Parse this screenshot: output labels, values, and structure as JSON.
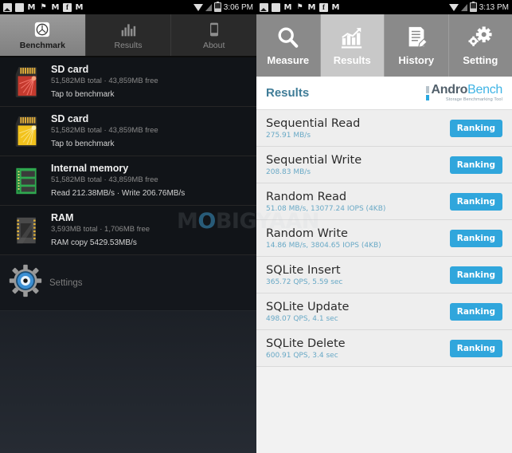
{
  "left_phone": {
    "statusbar": {
      "icons": [
        "photo-icon",
        "blank-square-icon",
        "m-icon",
        "flag-icon",
        "m-icon",
        "facebook-icon",
        "m-icon"
      ],
      "wifi": "wifi-icon",
      "signal": "signal-icon",
      "battery": "battery-icon",
      "time": "3:06 PM"
    },
    "tabs": [
      {
        "label": "Benchmark",
        "icon": "gauge-icon",
        "active": true
      },
      {
        "label": "Results",
        "icon": "bar-chart-icon",
        "active": false
      },
      {
        "label": "About",
        "icon": "phone-icon",
        "active": false
      }
    ],
    "benchmarks": [
      {
        "title": "SD card",
        "subtitle": "51,582MB total · 43,859MB free",
        "action": "Tap to benchmark",
        "icon": "sdcard-red-icon"
      },
      {
        "title": "SD card",
        "subtitle": "51,582MB total · 43,859MB free",
        "action": "Tap to benchmark",
        "icon": "sdcard-yellow-icon"
      },
      {
        "title": "Internal memory",
        "subtitle": "51,582MB total · 43,859MB free",
        "action": "Read 212.38MB/s · Write 206.76MB/s",
        "icon": "memory-chip-green-icon"
      },
      {
        "title": "RAM",
        "subtitle": "3,593MB total · 1,706MB free",
        "action": "RAM copy 5429.53MB/s",
        "icon": "ram-chip-icon"
      }
    ],
    "settings": {
      "label": "Settings",
      "icon": "gear-eye-icon"
    }
  },
  "watermark": {
    "prefix": "M",
    "highlight": "O",
    "suffix": "BIGYAAN"
  },
  "right_phone": {
    "statusbar": {
      "icons": [
        "photo-icon",
        "blank-square-icon",
        "m-icon",
        "flag-icon",
        "m-icon",
        "facebook-icon",
        "m-icon"
      ],
      "wifi": "wifi-icon",
      "signal": "signal-icon",
      "battery": "battery-icon",
      "time": "3:13 PM"
    },
    "nav": [
      {
        "label": "Measure",
        "icon": "magnifier-icon",
        "active": false
      },
      {
        "label": "Results",
        "icon": "chart-growth-icon",
        "active": true
      },
      {
        "label": "History",
        "icon": "document-pen-icon",
        "active": false
      },
      {
        "label": "Setting",
        "icon": "gears-icon",
        "active": false
      }
    ],
    "header": {
      "title": "Results",
      "logo_andro": "Andro",
      "logo_bench": "Bench",
      "logo_tagline": "Storage Benchmarking Tool"
    },
    "results": [
      {
        "name": "Sequential Read",
        "value": "275.91 MB/s",
        "button": "Ranking"
      },
      {
        "name": "Sequential Write",
        "value": "208.83 MB/s",
        "button": "Ranking"
      },
      {
        "name": "Random Read",
        "value": "51.08 MB/s, 13077.24 IOPS (4KB)",
        "button": "Ranking"
      },
      {
        "name": "Random Write",
        "value": "14.86 MB/s, 3804.65 IOPS (4KB)",
        "button": "Ranking"
      },
      {
        "name": "SQLite Insert",
        "value": "365.72 QPS, 5.59 sec",
        "button": "Ranking"
      },
      {
        "name": "SQLite Update",
        "value": "498.07 QPS, 4.1 sec",
        "button": "Ranking"
      },
      {
        "name": "SQLite Delete",
        "value": "600.91 QPS, 3.4 sec",
        "button": "Ranking"
      }
    ]
  },
  "colors": {
    "accent_blue": "#30a6dc",
    "title_blue": "#3f7c97",
    "value_blue": "#69a9c6",
    "dark_bg": "#14171c",
    "nav_gray": "#8a8a8a",
    "nav_active": "#c8c8c8"
  }
}
